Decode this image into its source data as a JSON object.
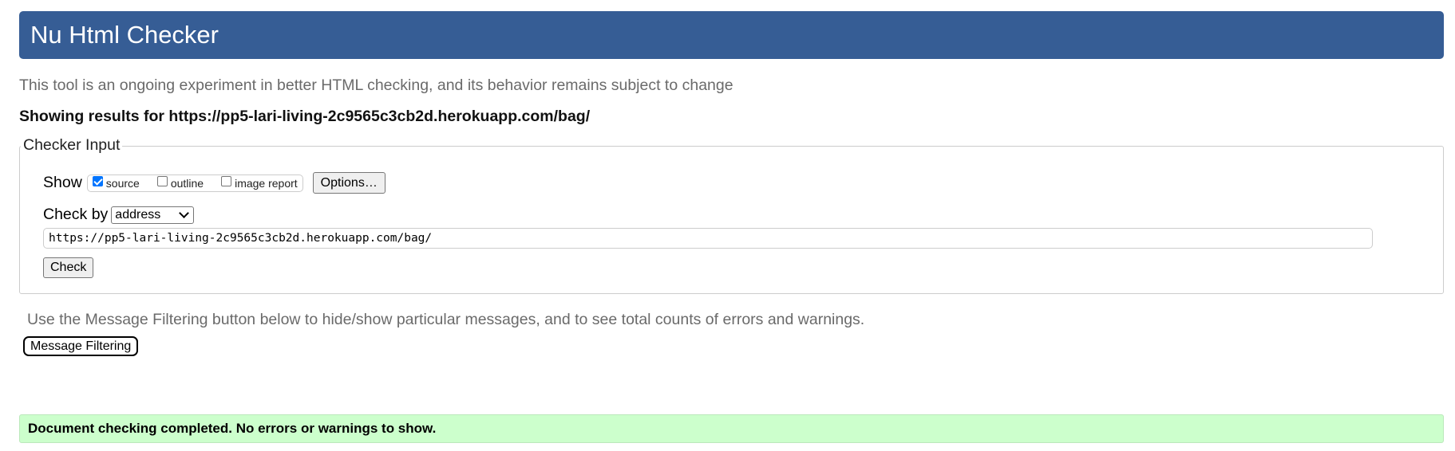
{
  "header": {
    "title": "Nu Html Checker"
  },
  "tagline": "This tool is an ongoing experiment in better HTML checking, and its behavior remains subject to change",
  "results": {
    "text": "Showing results for https://pp5-lari-living-2c9565c3cb2d.herokuapp.com/bag/"
  },
  "checker_input": {
    "legend": "Checker Input",
    "show_label": "Show",
    "options": [
      {
        "label": "source",
        "checked": true
      },
      {
        "label": "outline",
        "checked": false
      },
      {
        "label": "image report",
        "checked": false
      }
    ],
    "options_button": "Options…",
    "check_by_label": "Check by",
    "check_by_value": "address",
    "url_value": "https://pp5-lari-living-2c9565c3cb2d.herokuapp.com/bag/",
    "check_button": "Check"
  },
  "filtering": {
    "text": "Use the Message Filtering button below to hide/show particular messages, and to see total counts of errors and warnings.",
    "button": "Message Filtering"
  },
  "status": {
    "message": "Document checking completed. No errors or warnings to show."
  },
  "colors": {
    "header_bg": "#365d95",
    "success_bg": "#ccffcc",
    "checkbox_accent": "#0075ff"
  }
}
